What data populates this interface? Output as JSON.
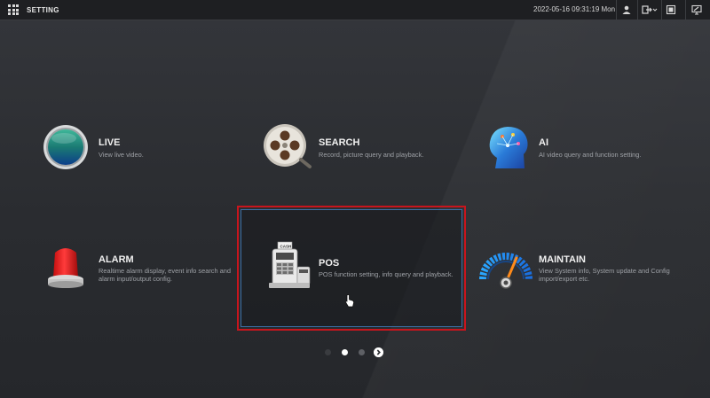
{
  "header": {
    "title": "SETTING",
    "datetime": "2022-05-16 09:31:19 Mon"
  },
  "tiles": {
    "live": {
      "title": "LIVE",
      "desc": "View live video."
    },
    "search": {
      "title": "SEARCH",
      "desc": "Record, picture query and playback."
    },
    "ai": {
      "title": "AI",
      "desc": "AI video query and function setting."
    },
    "alarm": {
      "title": "ALARM",
      "desc_line1": "Realtime alarm display, event info search and",
      "desc_line2": "alarm input/output config."
    },
    "pos": {
      "title": "POS",
      "desc": "POS function setting, info query and playback.",
      "receipt_text": "CASH"
    },
    "maintain": {
      "title": "MAINTAIN",
      "desc_line1": "View System info, System update and Config",
      "desc_line2": "import/export etc."
    }
  },
  "pager": {
    "page_count": 3,
    "current_page": 2
  },
  "colors": {
    "highlight_border": "#c8151d",
    "selected_inner_border": "#3b6fa6"
  },
  "icons": [
    "menu-grid-icon",
    "user-icon",
    "logout-icon",
    "fullscreen-icon",
    "monitor-icon",
    "next-page-icon",
    "mouse-cursor-icon"
  ]
}
